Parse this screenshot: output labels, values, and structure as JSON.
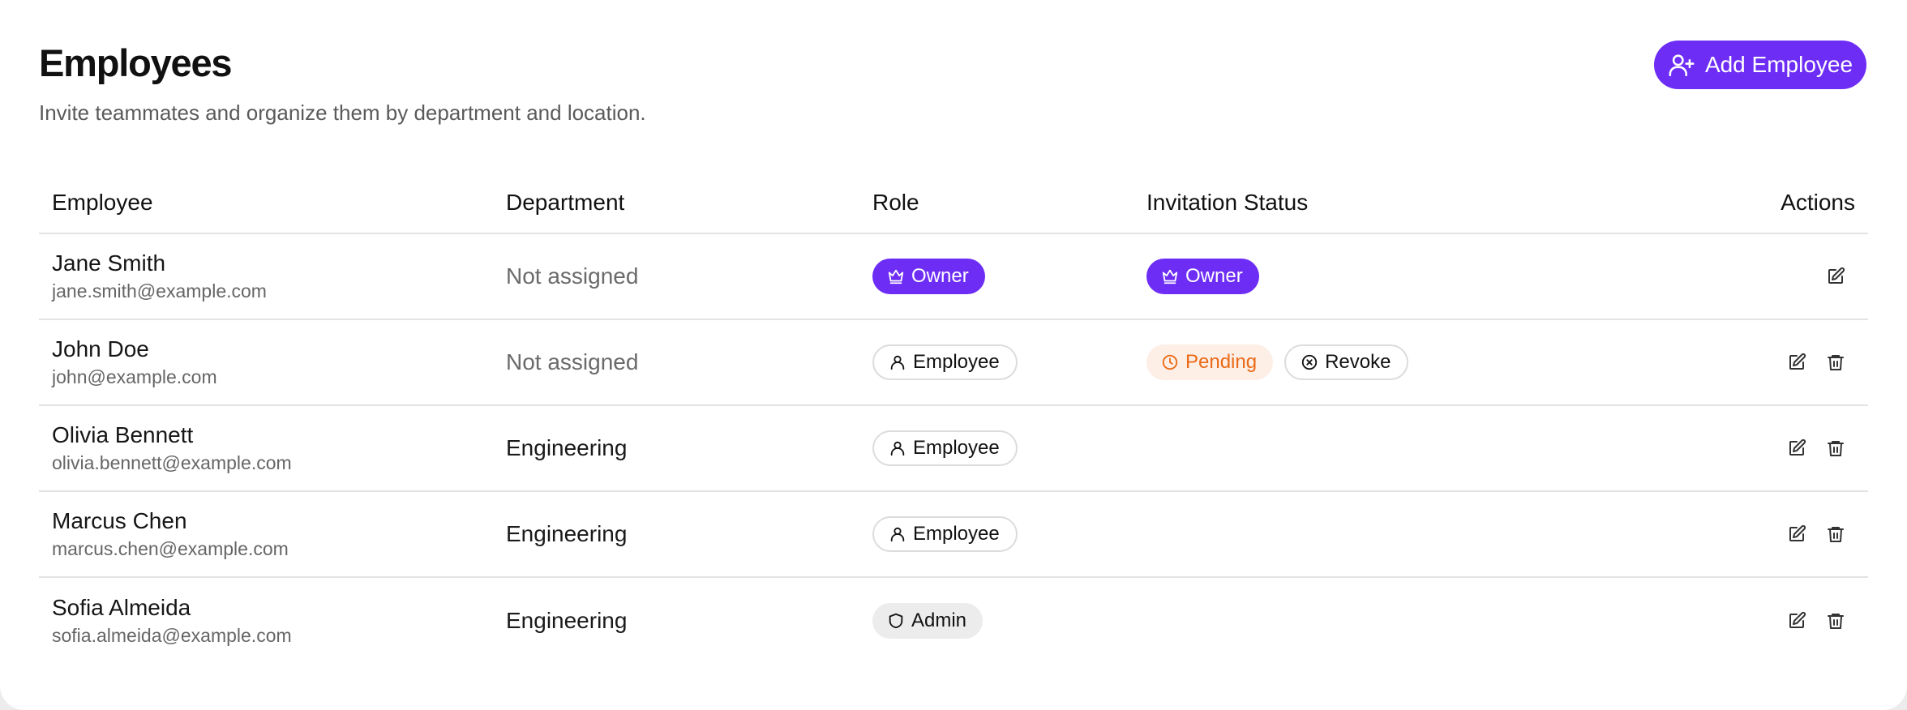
{
  "header": {
    "title": "Employees",
    "subtitle": "Invite teammates and organize them by department and location.",
    "add_button_label": "Add Employee",
    "add_button_icon": "user-plus-icon"
  },
  "colors": {
    "accent": "#6d2df5",
    "pending_text": "#ea6a16",
    "pending_bg": "#fdeee6"
  },
  "table": {
    "columns": [
      "Employee",
      "Department",
      "Role",
      "Invitation Status",
      "Actions"
    ],
    "rows": [
      {
        "name": "Jane Smith",
        "email": "jane.smith@example.com",
        "department": "Not assigned",
        "role": "Owner",
        "role_icon": "crown-icon",
        "status": "Owner",
        "status_icon": "crown-icon",
        "revoke_label": "",
        "actions": [
          "edit-icon"
        ]
      },
      {
        "name": "John Doe",
        "email": "john@example.com",
        "department": "Not assigned",
        "role": "Employee",
        "role_icon": "user-icon",
        "status": "Pending",
        "status_icon": "clock-icon",
        "revoke_label": "Revoke",
        "revoke_icon": "x-circle-icon",
        "actions": [
          "edit-icon",
          "trash-icon"
        ]
      },
      {
        "name": "Olivia Bennett",
        "email": "olivia.bennett@example.com",
        "department": "Engineering",
        "role": "Employee",
        "role_icon": "user-icon",
        "status": "",
        "revoke_label": "",
        "actions": [
          "edit-icon",
          "trash-icon"
        ]
      },
      {
        "name": "Marcus Chen",
        "email": "marcus.chen@example.com",
        "department": "Engineering",
        "role": "Employee",
        "role_icon": "user-icon",
        "status": "",
        "revoke_label": "",
        "actions": [
          "edit-icon",
          "trash-icon"
        ]
      },
      {
        "name": "Sofia Almeida",
        "email": "sofia.almeida@example.com",
        "department": "Engineering",
        "role": "Admin",
        "role_icon": "shield-icon",
        "status": "",
        "revoke_label": "",
        "actions": [
          "edit-icon",
          "trash-icon"
        ]
      }
    ]
  }
}
